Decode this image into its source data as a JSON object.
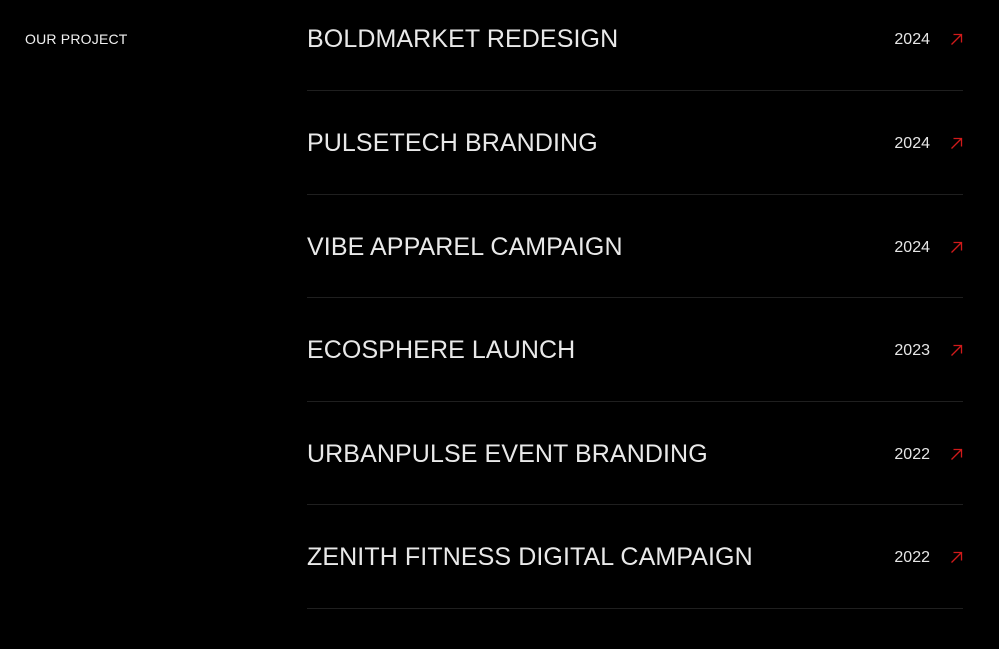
{
  "section": {
    "label": "OUR PROJECT"
  },
  "colors": {
    "background": "#000000",
    "text": "#e9e9e9",
    "divider": "#1f1f1f",
    "accent": "#d11a1a"
  },
  "projects": [
    {
      "title": "BOLDMARKET REDESIGN",
      "year": "2024",
      "icon": "arrow-up-right-icon"
    },
    {
      "title": "PULSETECH BRANDING",
      "year": "2024",
      "icon": "arrow-up-right-icon"
    },
    {
      "title": "VIBE APPAREL CAMPAIGN",
      "year": "2024",
      "icon": "arrow-up-right-icon"
    },
    {
      "title": "ECOSPHERE LAUNCH",
      "year": "2023",
      "icon": "arrow-up-right-icon"
    },
    {
      "title": "URBANPULSE EVENT BRANDING",
      "year": "2022",
      "icon": "arrow-up-right-icon"
    },
    {
      "title": "ZENITH FITNESS DIGITAL CAMPAIGN",
      "year": "2022",
      "icon": "arrow-up-right-icon"
    }
  ]
}
